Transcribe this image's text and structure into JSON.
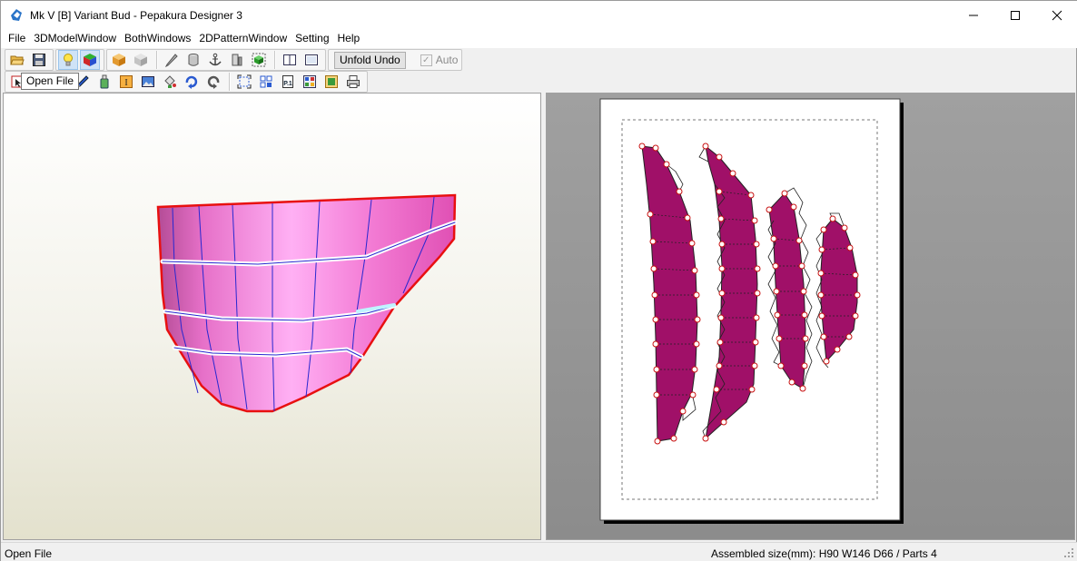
{
  "window": {
    "title": "Mk V [B] Variant Bud - Pepakura Designer 3",
    "controls": [
      "minimize",
      "maximize",
      "close"
    ]
  },
  "menu": {
    "items": [
      "File",
      "3DModelWindow",
      "BothWindows",
      "2DPatternWindow",
      "Setting",
      "Help"
    ]
  },
  "toolbar1": {
    "unfold_undo_label": "Unfold Undo",
    "auto_label": "Auto",
    "auto_checked": true,
    "auto_enabled": false
  },
  "tooltip": {
    "text": "Open File"
  },
  "status": {
    "left": "Open File",
    "right": "Assembled size(mm): H90 W146 D66 / Parts 4"
  },
  "colors": {
    "model_face": "#f58ad4",
    "part_fill": "#a01068",
    "cut_line": "#e81010",
    "fold_line": "#1a1acc"
  }
}
